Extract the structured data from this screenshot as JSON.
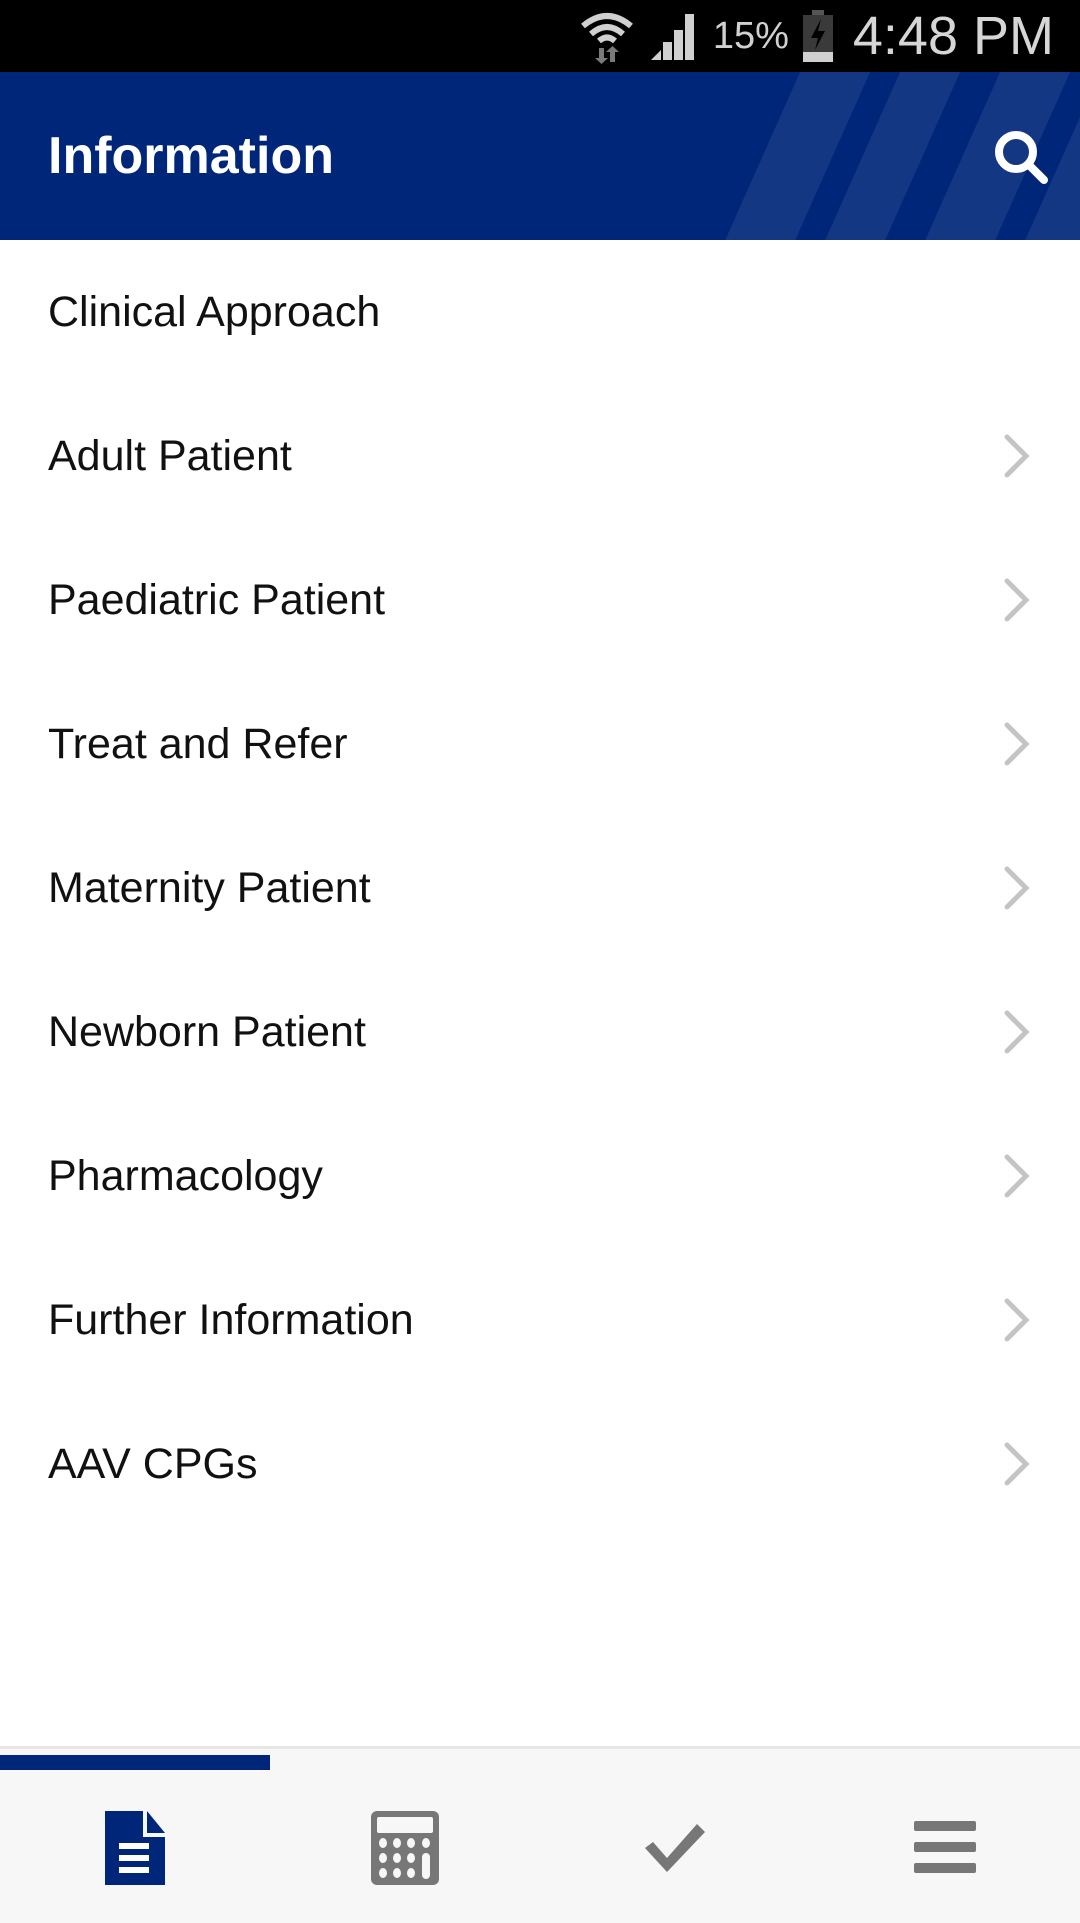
{
  "status_bar": {
    "wifi_icon": "wifi-data-icon",
    "signal_icon": "cell-signal-icon",
    "battery_percent": "15%",
    "battery_icon": "battery-charging-icon",
    "time": "4:48 PM"
  },
  "header": {
    "title": "Information",
    "search_icon": "search-icon",
    "background_color": "#00267a"
  },
  "list": {
    "items": [
      {
        "label": "Clinical Approach",
        "has_chevron": false
      },
      {
        "label": "Adult Patient",
        "has_chevron": true
      },
      {
        "label": "Paediatric Patient",
        "has_chevron": true
      },
      {
        "label": "Treat and Refer",
        "has_chevron": true
      },
      {
        "label": "Maternity Patient",
        "has_chevron": true
      },
      {
        "label": "Newborn Patient",
        "has_chevron": true
      },
      {
        "label": "Pharmacology",
        "has_chevron": true
      },
      {
        "label": "Further Information",
        "has_chevron": true
      },
      {
        "label": "AAV CPGs",
        "has_chevron": true
      }
    ]
  },
  "bottom_nav": {
    "active_index": 0,
    "active_color": "#00267a",
    "inactive_color": "#777777",
    "tabs": [
      {
        "icon": "document-icon",
        "name": "information"
      },
      {
        "icon": "calculator-icon",
        "name": "calculator"
      },
      {
        "icon": "checkmark-icon",
        "name": "checklist"
      },
      {
        "icon": "menu-icon",
        "name": "menu"
      }
    ]
  }
}
